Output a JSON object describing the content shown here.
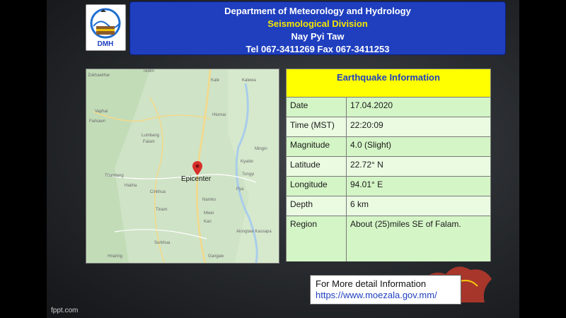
{
  "header": {
    "line1": "Department of Meteorology and Hydrology",
    "line2": "Seismological  Division",
    "line3": "Nay Pyi Taw",
    "line4": "Tel 067-3411269  Fax 067-3411253"
  },
  "logo": {
    "text": "DMH"
  },
  "map": {
    "epicenter_label": "Epicenter",
    "places": [
      "Zokhawthar",
      "Tedim",
      "Kale",
      "Kalewa",
      "Vaphai",
      "Htomar",
      "Farkawn",
      "Lumbang",
      "Falam",
      "Mingin",
      "Kyabin",
      "Thantlang",
      "Tongyi",
      "Hakha",
      "Cinkhua",
      "Pya",
      "Tinam",
      "Namko",
      "Mwei",
      "Kan",
      "Alongtaw Kassapa",
      "Surkhua",
      "Hnaring",
      "Gangaw"
    ],
    "colors": {
      "land": "#cfe3c6",
      "road": "#f3d98a",
      "river": "#a9cdea",
      "marker": "#d9302c"
    }
  },
  "info": {
    "title": "Earthquake Information",
    "rows": [
      {
        "label": "Date",
        "value": "17.04.2020"
      },
      {
        "label": "Time (MST)",
        "value": "22:20:09"
      },
      {
        "label": "Magnitude",
        "value": "4.0 (Slight)"
      },
      {
        "label": "Latitude",
        "value": "22.72° N"
      },
      {
        "label": "Longitude",
        "value": "94.01° E"
      },
      {
        "label": "Depth",
        "value": "6 km"
      },
      {
        "label": "Region",
        "value": "About (25)miles SE of Falam."
      }
    ]
  },
  "more_info": {
    "line1": "For More detail Information",
    "url": "https://www.moezala.gov.mm/"
  },
  "footer": {
    "text": "fppt.com"
  }
}
